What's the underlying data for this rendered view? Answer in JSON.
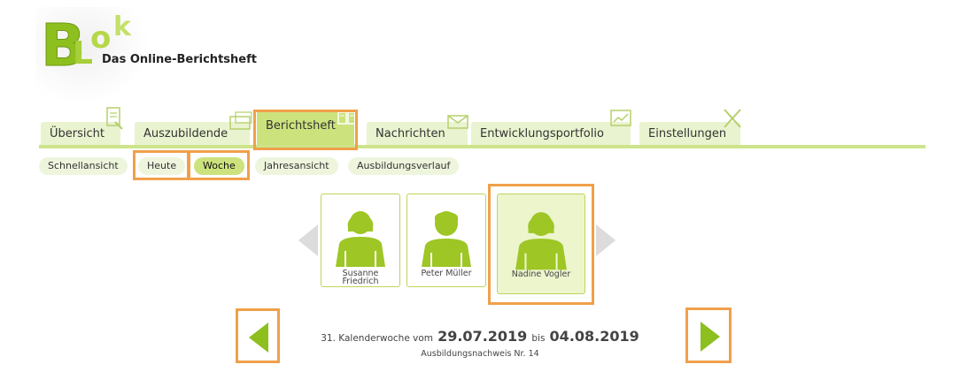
{
  "logo": {
    "mark_text": "BLok",
    "subtitle": "Das Online-Berichtsheft"
  },
  "tabs": [
    {
      "label": "Übersicht"
    },
    {
      "label": "Auszubildende"
    },
    {
      "label": "Berichtsheft"
    },
    {
      "label": "Nachrichten"
    },
    {
      "label": "Entwicklungsportfolio"
    },
    {
      "label": "Einstellungen"
    }
  ],
  "subnav": [
    {
      "label": "Schnellansicht"
    },
    {
      "label": "Heute"
    },
    {
      "label": "Woche"
    },
    {
      "label": "Jahresansicht"
    },
    {
      "label": "Ausbildungsverlauf"
    }
  ],
  "people": [
    {
      "name_line1": "Susanne",
      "name_line2": "Friedrich"
    },
    {
      "name_line1": "Peter Müller",
      "name_line2": ""
    },
    {
      "name_line1": "Nadine Vogler",
      "name_line2": ""
    }
  ],
  "week": {
    "prefix": "31. Kalenderwoche vom",
    "from": "29.07.2019",
    "bis": "bis",
    "to": "04.08.2019",
    "nachweis": "Ausbildungsnachweis Nr. 14"
  },
  "colors": {
    "accent": "#8dbf1f",
    "accent_light": "#cce27c",
    "highlight": "#f0a04b"
  },
  "icons": {
    "prev": "arrow-left-icon",
    "next": "arrow-right-icon",
    "carousel_prev": "chevron-left-icon",
    "carousel_next": "chevron-right-icon"
  }
}
